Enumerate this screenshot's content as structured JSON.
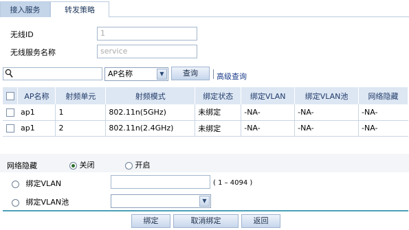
{
  "tabs": [
    {
      "label": "接入服务",
      "active": true
    },
    {
      "label": "转发策略",
      "active": false
    }
  ],
  "form": {
    "wireless_id_label": "无线ID",
    "wireless_id_value": "1",
    "service_name_label": "无线服务名称",
    "service_name_value": "service"
  },
  "search": {
    "query": "",
    "filter_selected": "AP名称",
    "query_button": "查询",
    "advanced_link": "高级查询"
  },
  "table": {
    "headers": [
      "AP名称",
      "射频单元",
      "射频模式",
      "绑定状态",
      "绑定VLAN",
      "绑定VLAN池",
      "网络隐藏"
    ],
    "rows": [
      {
        "ap": "ap1",
        "radio": "1",
        "mode": "802.11n(5GHz)",
        "state": "未绑定",
        "vlan": "-NA-",
        "vlan_pool": "-NA-",
        "hidden": "-NA-"
      },
      {
        "ap": "ap1",
        "radio": "2",
        "mode": "802.11n(2.4GHz)",
        "state": "未绑定",
        "vlan": "-NA-",
        "vlan_pool": "-NA-",
        "hidden": "-NA-"
      }
    ]
  },
  "options": {
    "network_hide_label": "网络隐藏",
    "off_label": "关闭",
    "on_label": "开启",
    "bind_vlan_label": "绑定VLAN",
    "bind_vlan_value": "",
    "vlan_range": "( 1 – 4094 )",
    "bind_vlan_pool_label": "绑定VLAN池",
    "bind_vlan_pool_value": ""
  },
  "buttons": {
    "bind": "绑定",
    "unbind": "取消绑定",
    "back": "返回"
  },
  "colors": {
    "tab_active": "#c4d5ea",
    "table_header": "#dde7f3",
    "divider": "#4aa0b8",
    "link": "#1a3c8a"
  }
}
